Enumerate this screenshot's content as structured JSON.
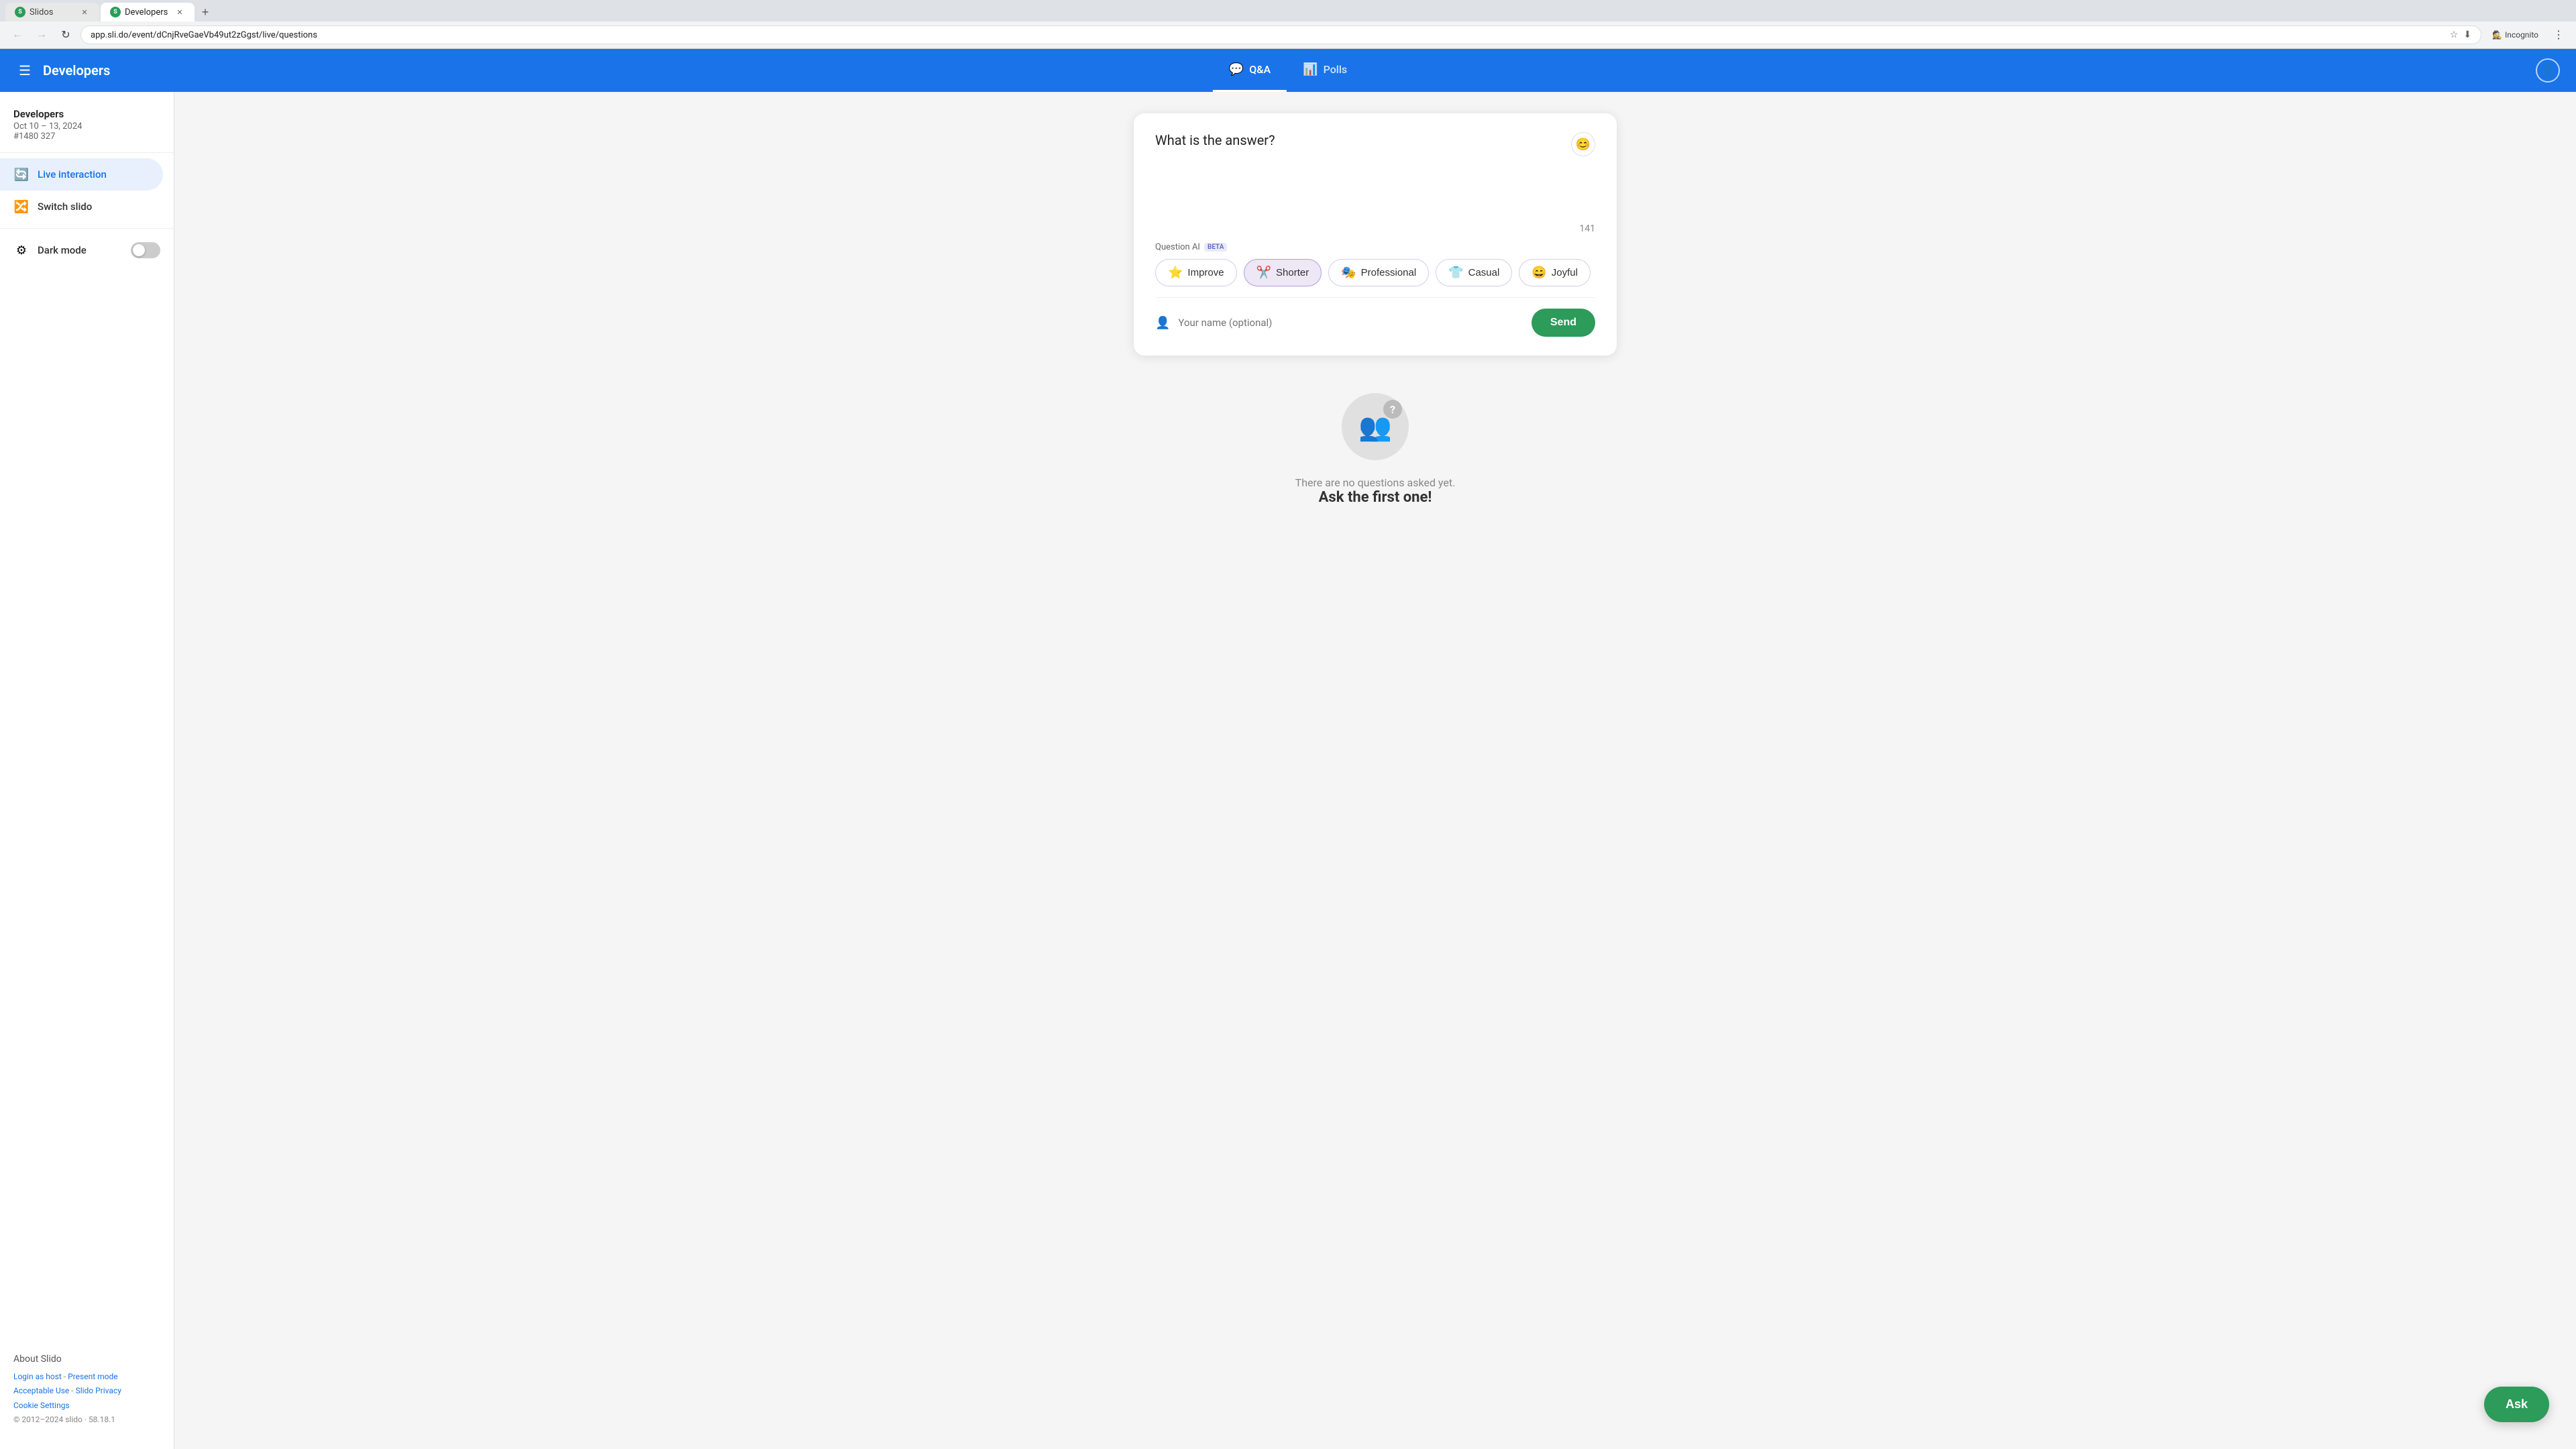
{
  "browser": {
    "tabs": [
      {
        "id": "tab-slidos",
        "label": "Slidos",
        "favicon_color": "#2d9b5a",
        "favicon_letter": "S",
        "active": false
      },
      {
        "id": "tab-developers",
        "label": "Developers",
        "favicon_color": "#2d9b5a",
        "favicon_letter": "S",
        "active": true
      }
    ],
    "new_tab_label": "+",
    "url": "app.sli.do/event/dCnjRveGaeVb49ut2zGgst/live/questions",
    "incognito_label": "Incognito"
  },
  "header": {
    "hamburger_label": "☰",
    "title": "Developers",
    "nav_tabs": [
      {
        "id": "qa",
        "icon": "💬",
        "label": "Q&A",
        "active": true
      },
      {
        "id": "polls",
        "icon": "📊",
        "label": "Polls",
        "active": false
      }
    ],
    "profile_icon": "👤"
  },
  "sidebar": {
    "event_name": "Developers",
    "event_dates": "Oct 10 – 13, 2024",
    "event_id": "#1480 327",
    "items": [
      {
        "id": "live-interaction",
        "icon": "🔄",
        "label": "Live interaction",
        "active": true
      },
      {
        "id": "switch-slido",
        "icon": "🔀",
        "label": "Switch slido",
        "active": false
      }
    ],
    "dark_mode_label": "Dark mode",
    "dark_mode_on": false,
    "about_label": "About Slido",
    "footer": {
      "login_link": "Login as host",
      "separator1": " - ",
      "present_link": "Present mode",
      "acceptable_use_link": "Acceptable Use",
      "separator2": " - ",
      "privacy_link": "Slido Privacy",
      "cookie_link": "Cookie Settings",
      "copyright": "© 2012–2024 slido · 58.18.1"
    }
  },
  "question_card": {
    "question_text": "What is the answer?",
    "emoji_icon": "😊",
    "char_count": "141",
    "ai_section": {
      "label": "Question AI",
      "beta_badge": "BETA",
      "buttons": [
        {
          "id": "improve",
          "icon": "⭐",
          "label": "Improve",
          "active": false
        },
        {
          "id": "shorter",
          "icon": "✂️",
          "label": "Shorter",
          "active": true
        },
        {
          "id": "professional",
          "icon": "🎭",
          "label": "Professional",
          "active": false
        },
        {
          "id": "casual",
          "icon": "👕",
          "label": "Casual",
          "active": false
        },
        {
          "id": "joyful",
          "icon": "😄",
          "label": "Joyful",
          "active": false
        }
      ]
    },
    "name_placeholder": "Your name (optional)",
    "send_label": "Send"
  },
  "empty_state": {
    "question_mark": "?",
    "subtitle": "There are no questions asked yet.",
    "title": "Ask the first one!"
  },
  "fab": {
    "label": "Ask"
  }
}
